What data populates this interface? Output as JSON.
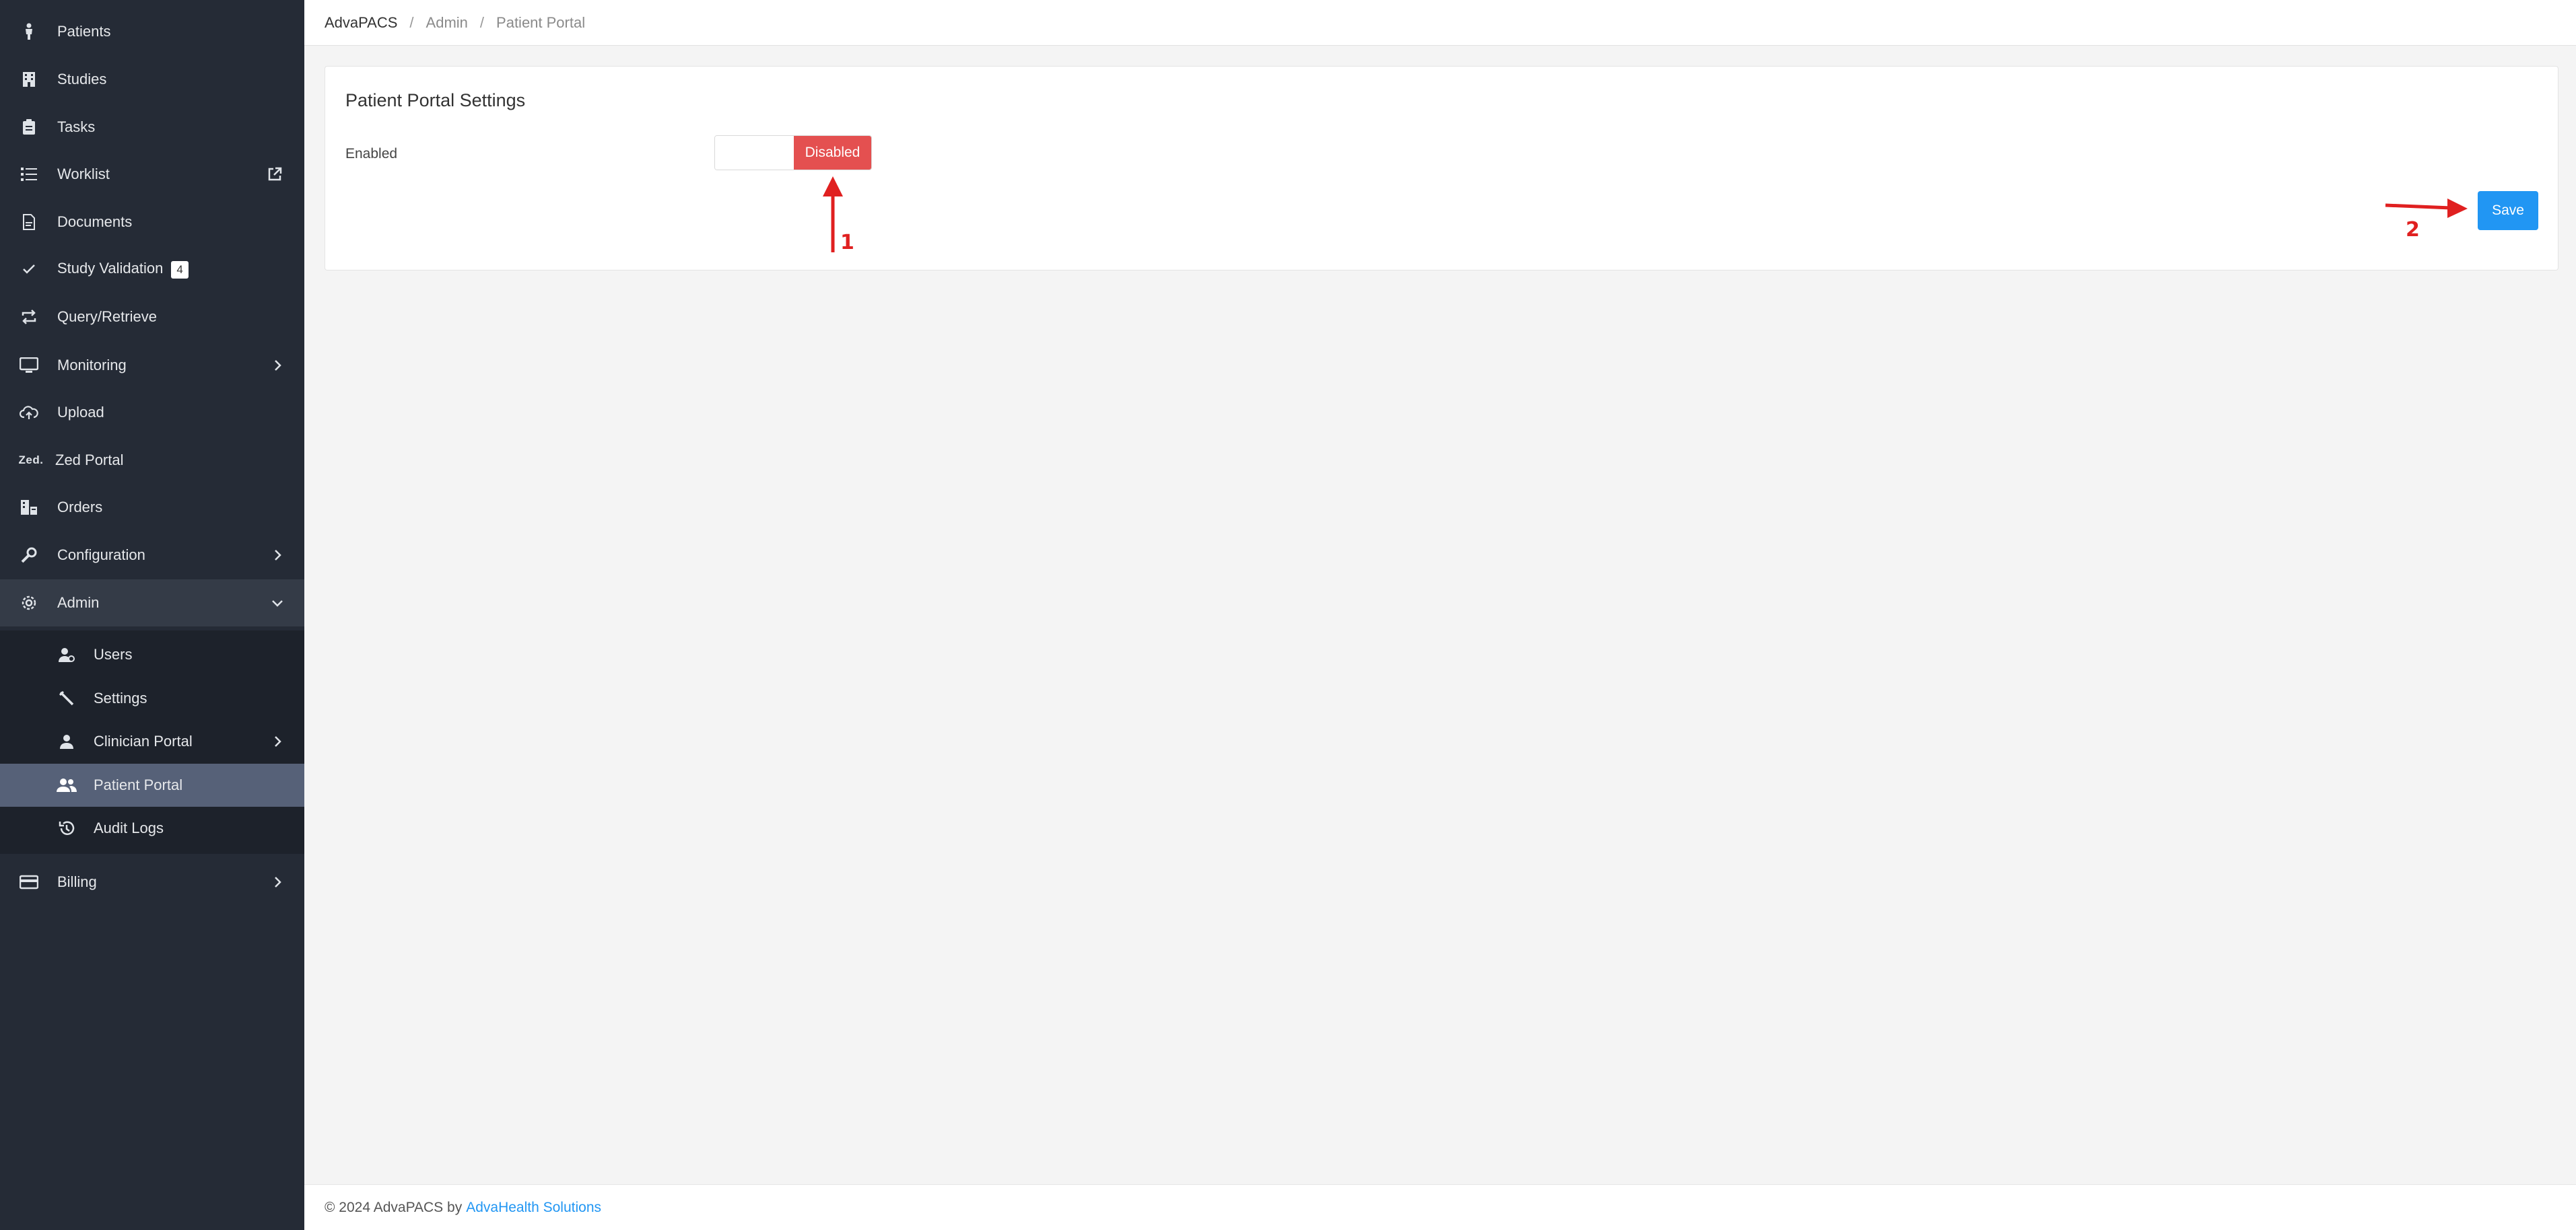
{
  "sidebar": {
    "items": [
      {
        "label": "Patients",
        "icon": "person-standing-icon"
      },
      {
        "label": "Studies",
        "icon": "building-icon"
      },
      {
        "label": "Tasks",
        "icon": "clipboard-icon"
      },
      {
        "label": "Worklist",
        "icon": "list-icon",
        "extra_icon": "external-link-icon"
      },
      {
        "label": "Documents",
        "icon": "document-icon"
      },
      {
        "label": "Study Validation",
        "icon": "check-icon",
        "badge": "4"
      },
      {
        "label": "Query/Retrieve",
        "icon": "retweet-icon"
      },
      {
        "label": "Monitoring",
        "icon": "monitor-icon",
        "chevron": "chevron-right-icon"
      },
      {
        "label": "Upload",
        "icon": "cloud-upload-icon"
      },
      {
        "label": "Zed Portal",
        "icon_text": "Zed."
      },
      {
        "label": "Orders",
        "icon": "orders-icon"
      },
      {
        "label": "Configuration",
        "icon": "wrench-gear-icon",
        "chevron": "chevron-right-icon"
      },
      {
        "label": "Admin",
        "icon": "gear-icon",
        "chevron": "chevron-down-icon"
      }
    ],
    "admin_submenu": [
      {
        "label": "Users",
        "icon": "user-settings-icon"
      },
      {
        "label": "Settings",
        "icon": "tools-icon"
      },
      {
        "label": "Clinician Portal",
        "icon": "user-icon",
        "chevron": "chevron-right-icon"
      },
      {
        "label": "Patient Portal",
        "icon": "users-icon",
        "active": true
      },
      {
        "label": "Audit Logs",
        "icon": "history-icon"
      }
    ],
    "billing": {
      "label": "Billing",
      "icon": "credit-card-icon",
      "chevron": "chevron-right-icon"
    }
  },
  "breadcrumb": {
    "home": "AdvaPACS",
    "items": [
      "Admin",
      "Patient Portal"
    ],
    "separator": "/"
  },
  "card": {
    "title": "Patient Portal Settings",
    "enabled_label": "Enabled",
    "toggle_state": "Disabled",
    "save_label": "Save"
  },
  "annotations": {
    "step1": "1",
    "step2": "2",
    "color": "#e02020"
  },
  "footer": {
    "copyright": "© 2024 AdvaPACS by",
    "link_text": "AdvaHealth Solutions"
  },
  "colors": {
    "sidebar_bg": "#252b36",
    "submenu_bg": "#1d222b",
    "active_item_bg": "#566178",
    "toggle_disabled": "#e45050",
    "primary": "#2196f3"
  }
}
